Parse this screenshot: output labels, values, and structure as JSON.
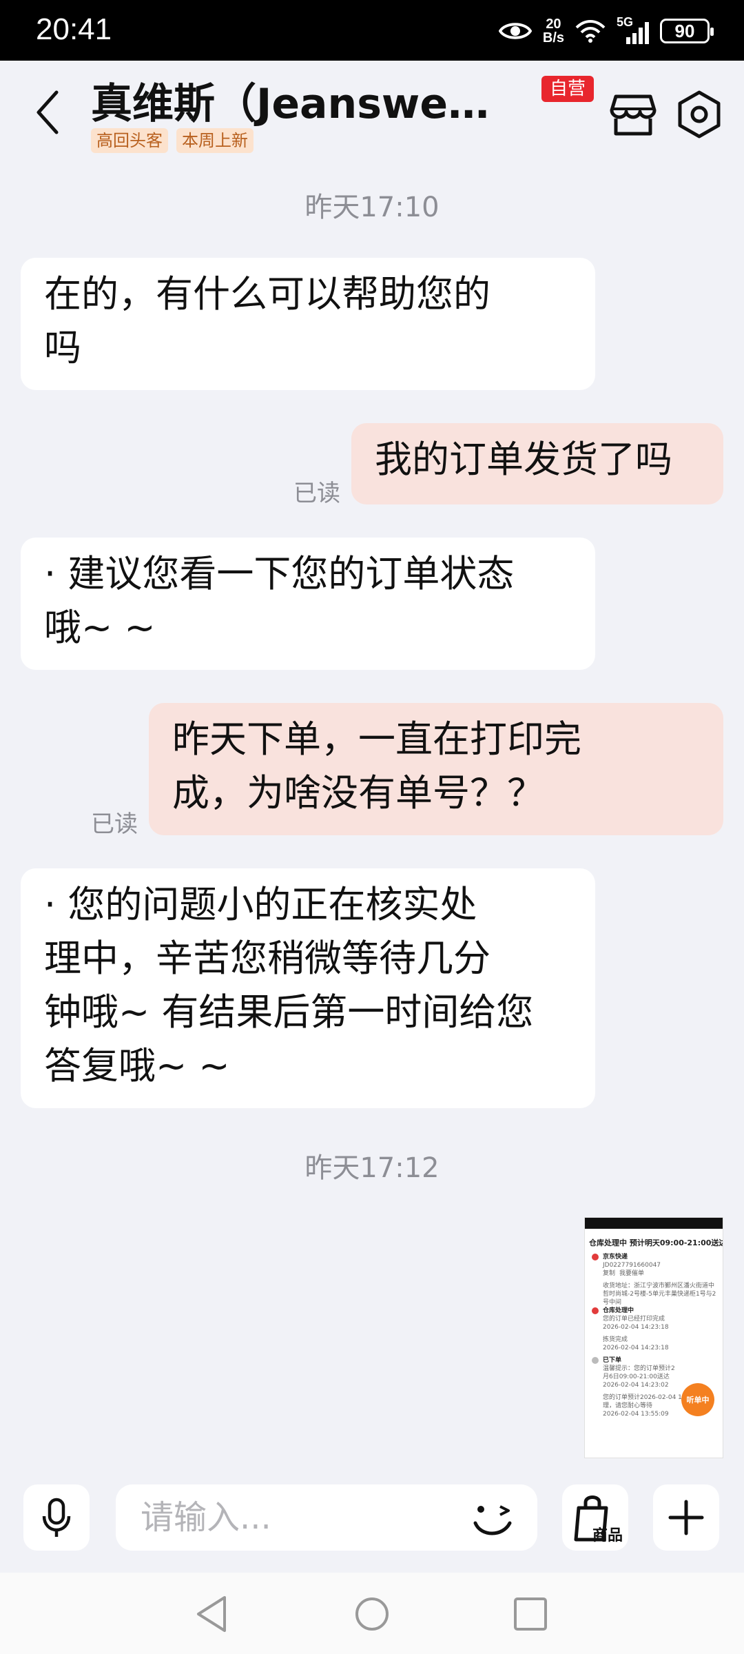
{
  "status_bar": {
    "time": "20:41",
    "net_speed_value": "20",
    "net_speed_unit": "B/s",
    "network": "5G",
    "battery": "90"
  },
  "header": {
    "title": "真维斯（Jeanswest...",
    "self_operated_tag": "自营",
    "tags": [
      "高回头客",
      "本周上新"
    ]
  },
  "chat": {
    "timestamps": [
      "昨天17:10",
      "昨天17:12"
    ],
    "messages": [
      {
        "direction": "in",
        "lines": [
          "在的，有什么可以帮助您的",
          "吗"
        ]
      },
      {
        "direction": "out",
        "lines": [
          "我的订单发货了吗"
        ],
        "status": "已读"
      },
      {
        "direction": "in",
        "lines": [
          "· 建议您看一下您的订单状态",
          "哦~ ~"
        ]
      },
      {
        "direction": "out",
        "lines": [
          "昨天下单，一直在打印完",
          "成，为啥没有单号？？"
        ],
        "status": "已读"
      },
      {
        "direction": "in",
        "lines": [
          "·  您的问题小的正在核实处",
          "理中，辛苦您稍微等待几分",
          "钟哦~ 有结果后第一时间给您",
          "答复哦~  ~"
        ]
      }
    ],
    "image_message": {
      "header": "仓库处理中 预计明天09:00-21:00送达",
      "courier": "京东快递",
      "tracking": "JD0227791660047",
      "copy_label": "复制",
      "remind_label": "我要催单",
      "address": "收货地址：浙江宁波市鄞州区潘火街道中哲时尚城-2号楼-5单元丰巢快递柜1号与2号中间",
      "step1_title": "仓库处理中",
      "step1_desc": "您的订单已经打印完成",
      "step1_time": "2026-02-04 14:23:18",
      "step2_desc": "拣货完成",
      "step2_time": "2026-02-04 14:23:18",
      "step3_title": "已下单",
      "step3_desc": "温馨提示：您的订单预计2月6日09:00-21:00送达",
      "step3_time": "2026-02-04 14:23:02",
      "step4_desc": "您的订单预计2026-02-04 13:55开始处理，请您耐心等待",
      "step4_time": "2026-02-04 13:55:09",
      "badge": "听单中"
    }
  },
  "input_bar": {
    "placeholder": "请输入...",
    "product_label": "商品"
  }
}
